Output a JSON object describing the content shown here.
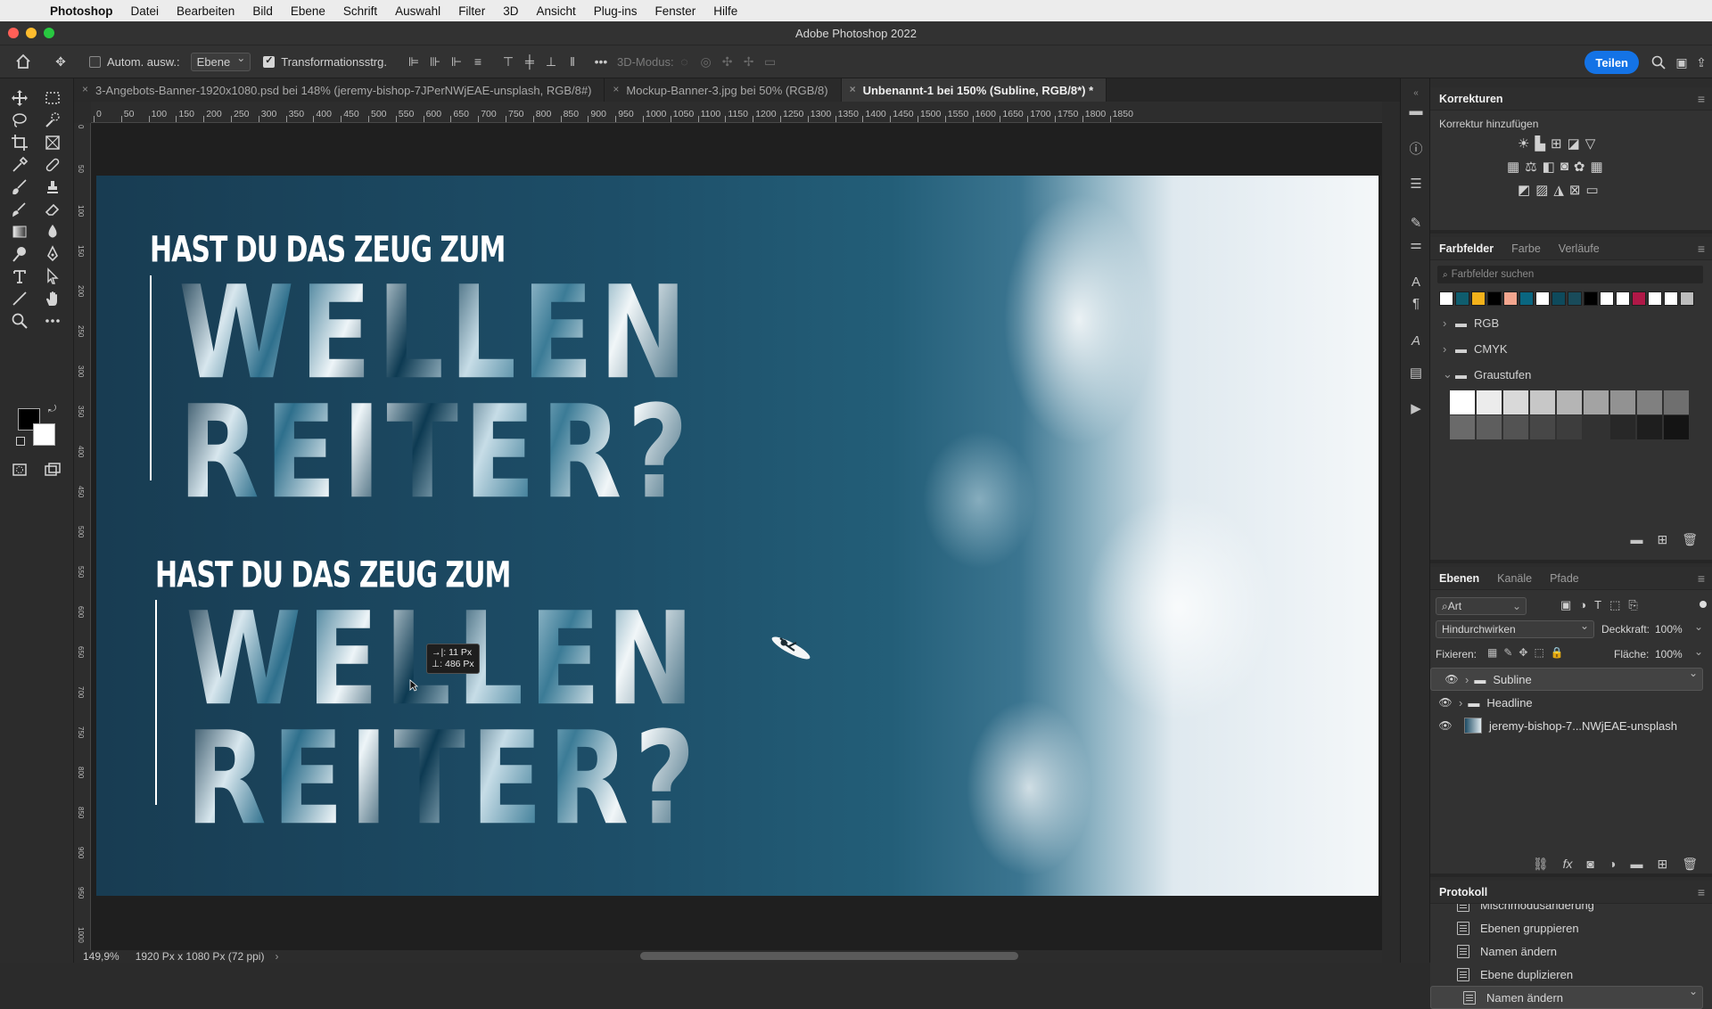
{
  "os_menu": {
    "app": "Photoshop",
    "items": [
      "Datei",
      "Bearbeiten",
      "Bild",
      "Ebene",
      "Schrift",
      "Auswahl",
      "Filter",
      "3D",
      "Ansicht",
      "Plug-ins",
      "Fenster",
      "Hilfe"
    ]
  },
  "window": {
    "title": "Adobe Photoshop 2022"
  },
  "options_bar": {
    "auto_select_label": "Autom. ausw.:",
    "auto_select_value": "Ebene",
    "transform_label": "Transformationsstrg.",
    "mode_3d_label": "3D-Modus:",
    "share_label": "Teilen"
  },
  "tabs": [
    {
      "label": "3-Angebots-Banner-1920x1080.psd bei 148% (jeremy-bishop-7JPerNWjEAE-unsplash, RGB/8#)"
    },
    {
      "label": "Mockup-Banner-3.jpg bei 50% (RGB/8)"
    },
    {
      "label": "Unbenannt-1 bei 150% (Subline, RGB/8*) *"
    }
  ],
  "ruler": {
    "top": [
      "0",
      "50",
      "100",
      "150",
      "200",
      "250",
      "300",
      "350",
      "400",
      "450",
      "500",
      "550",
      "600",
      "650",
      "700",
      "750",
      "800",
      "850",
      "900",
      "950",
      "1000",
      "1050",
      "1100",
      "1150",
      "1200",
      "1250",
      "1300",
      "1350",
      "1400",
      "1450",
      "1500",
      "1550",
      "1600",
      "1650",
      "1700",
      "1750",
      "1800",
      "1850"
    ],
    "left": [
      "0",
      "50",
      "100",
      "150",
      "200",
      "250",
      "300",
      "350",
      "400",
      "450",
      "500",
      "550",
      "600",
      "650",
      "700",
      "750",
      "800",
      "850",
      "900",
      "950",
      "1000"
    ]
  },
  "canvas": {
    "subline_1": "HAST DU DAS ZEUG ZUM",
    "headline_1a": "WELLEN",
    "headline_1b": "REITER?",
    "subline_2": "HAST DU DAS ZEUG ZUM",
    "headline_2a": "WELLEN",
    "headline_2b": "REITER?",
    "readout_x": "11 Px",
    "readout_y": "486 Px"
  },
  "status": {
    "zoom": "149,9%",
    "doc_info": "1920 Px x 1080 Px (72 ppi)"
  },
  "corrections_panel": {
    "title": "Korrekturen",
    "add_label": "Korrektur hinzufügen"
  },
  "swatches_panel": {
    "tabs": [
      "Farbfelder",
      "Farbe",
      "Verläufe"
    ],
    "search_placeholder": "Farbfelder suchen",
    "swatch_colors": [
      "#ffffff",
      "#0f5d6e",
      "#f3b21b",
      "#000000",
      "#f2a58e",
      "#0a6680",
      "#ffffff",
      "#0e4a5c",
      "#194b5a",
      "#000000",
      "#ffffff",
      "#ffffff",
      "#b01847",
      "#ffffff",
      "#ffffff",
      "#bdbdbd"
    ],
    "groups": [
      "RGB",
      "CMYK",
      "Graustufen"
    ],
    "grays_row1": [
      "#ffffff",
      "#ececec",
      "#d9d9d9",
      "#c7c7c7",
      "#b5b5b5",
      "#a3a3a3",
      "#929292",
      "#808080",
      "#6f6f6f"
    ],
    "grays_row2": [
      "#6a6a6a",
      "#5e5e5e",
      "#535353",
      "#474747",
      "#3d3d3d",
      "#323232",
      "#282828",
      "#1e1e1e",
      "#141414"
    ]
  },
  "layers_panel": {
    "tabs": [
      "Ebenen",
      "Kanäle",
      "Pfade"
    ],
    "filter_label": "Art",
    "blend_mode": "Hindurchwirken",
    "opacity_label": "Deckkraft:",
    "opacity_value": "100%",
    "lock_label": "Fixieren:",
    "fill_label": "Fläche:",
    "fill_value": "100%",
    "layers": [
      {
        "name": "Subline"
      },
      {
        "name": "Headline"
      },
      {
        "name": "jeremy-bishop-7...NWjEAE-unsplash"
      }
    ]
  },
  "history_panel": {
    "title": "Protokoll",
    "items": [
      "Mischmodusänderung",
      "Ebenen gruppieren",
      "Namen ändern",
      "Ebene duplizieren",
      "Namen ändern"
    ]
  }
}
